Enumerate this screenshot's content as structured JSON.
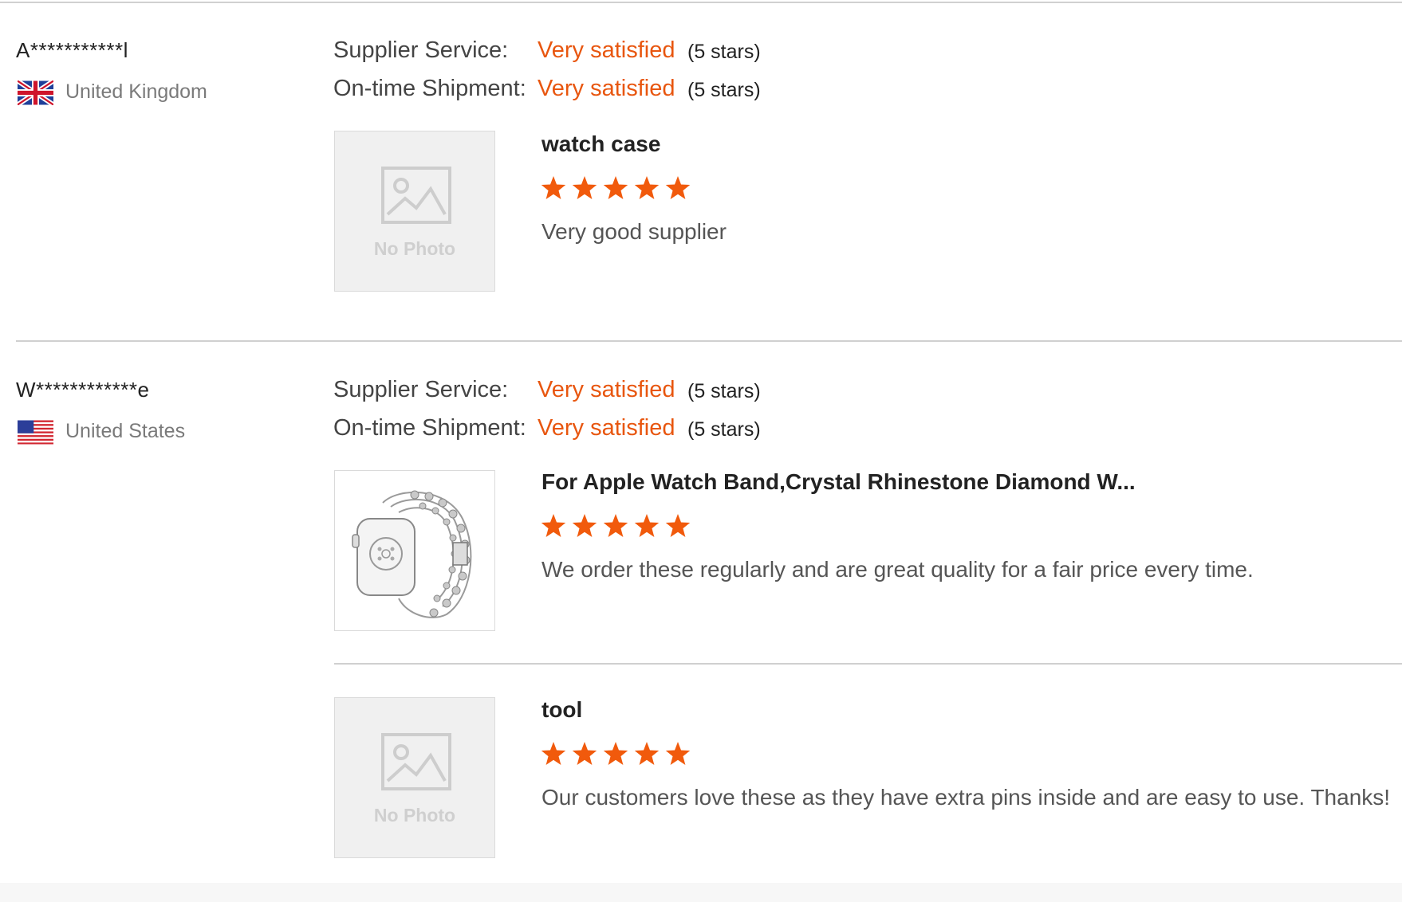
{
  "reviews": [
    {
      "user": "A***********l",
      "country": "United Kingdom",
      "flag": "uk-flag-icon",
      "supplier_service_label": "Supplier Service:",
      "supplier_service_value": "Very satisfied",
      "supplier_service_stars": "(5 stars)",
      "shipment_label": "On-time Shipment:",
      "shipment_value": "Very satisfied",
      "shipment_stars": "(5 stars)",
      "products": [
        {
          "title": "watch case",
          "rating": 5,
          "text": "Very good supplier",
          "photo_text": "No Photo"
        }
      ]
    },
    {
      "user": "W************e",
      "country": "United States",
      "flag": "us-flag-icon",
      "supplier_service_label": "Supplier Service:",
      "supplier_service_value": "Very satisfied",
      "supplier_service_stars": "(5 stars)",
      "shipment_label": "On-time Shipment:",
      "shipment_value": "Very satisfied",
      "shipment_stars": "(5 stars)",
      "products": [
        {
          "title": "For Apple Watch Band,Crystal Rhinestone Diamond W...",
          "rating": 5,
          "text": "We order these regularly and are great quality for a fair price every time.",
          "photo_text": ""
        },
        {
          "title": "tool",
          "rating": 5,
          "text": "Our customers love these as they have extra pins inside and are easy to use. Thanks!",
          "photo_text": "No Photo"
        }
      ]
    }
  ],
  "colors": {
    "accent": "#e8560f",
    "star": "#f15a0c"
  }
}
